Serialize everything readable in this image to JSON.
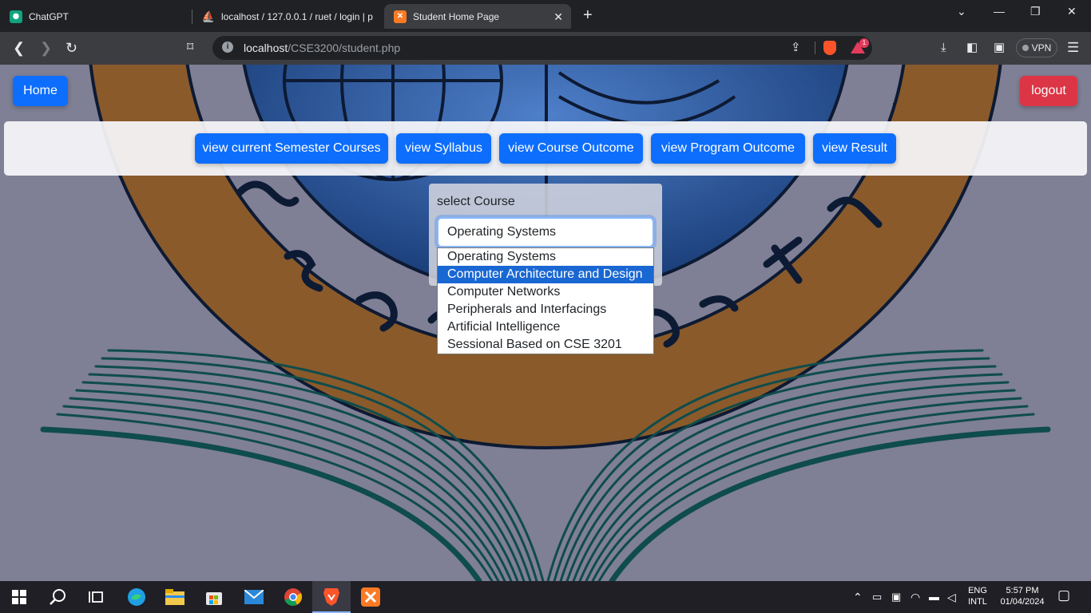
{
  "browser": {
    "tabs": [
      {
        "title": "ChatGPT",
        "favicon": "chatgpt-icon"
      },
      {
        "title": "localhost / 127.0.0.1 / ruet / login | p",
        "favicon": "phpmyadmin-icon"
      },
      {
        "title": "Student Home Page",
        "favicon": "xampp-icon",
        "active": true
      }
    ],
    "url_host": "localhost",
    "url_path": "/CSE3200/student.php",
    "vpn_label": "VPN",
    "rewards_badge": "1"
  },
  "page": {
    "home_label": "Home",
    "logout_label": "logout",
    "nav_buttons": [
      "view current Semester Courses",
      "view Syllabus",
      "view Course Outcome",
      "view Program Outcome",
      "view Result"
    ],
    "select_label": "select Course",
    "selected_course": "Operating Systems",
    "course_options": [
      "Operating Systems",
      "Computer Architecture and Design",
      "Computer Networks",
      "Peripherals and Interfacings",
      "Artificial Intelligence",
      "Sessional Based on CSE 3201"
    ],
    "highlighted_option": 1
  },
  "taskbar": {
    "lang_top": "ENG",
    "lang_bottom": "INTL",
    "time": "5:57 PM",
    "date": "01/04/2024"
  },
  "colors": {
    "primary": "#0d6efd",
    "danger": "#dc3545",
    "highlight": "#1967d2",
    "logo_bronze": "#8a5a2b",
    "logo_teal": "#0f4c4c"
  }
}
